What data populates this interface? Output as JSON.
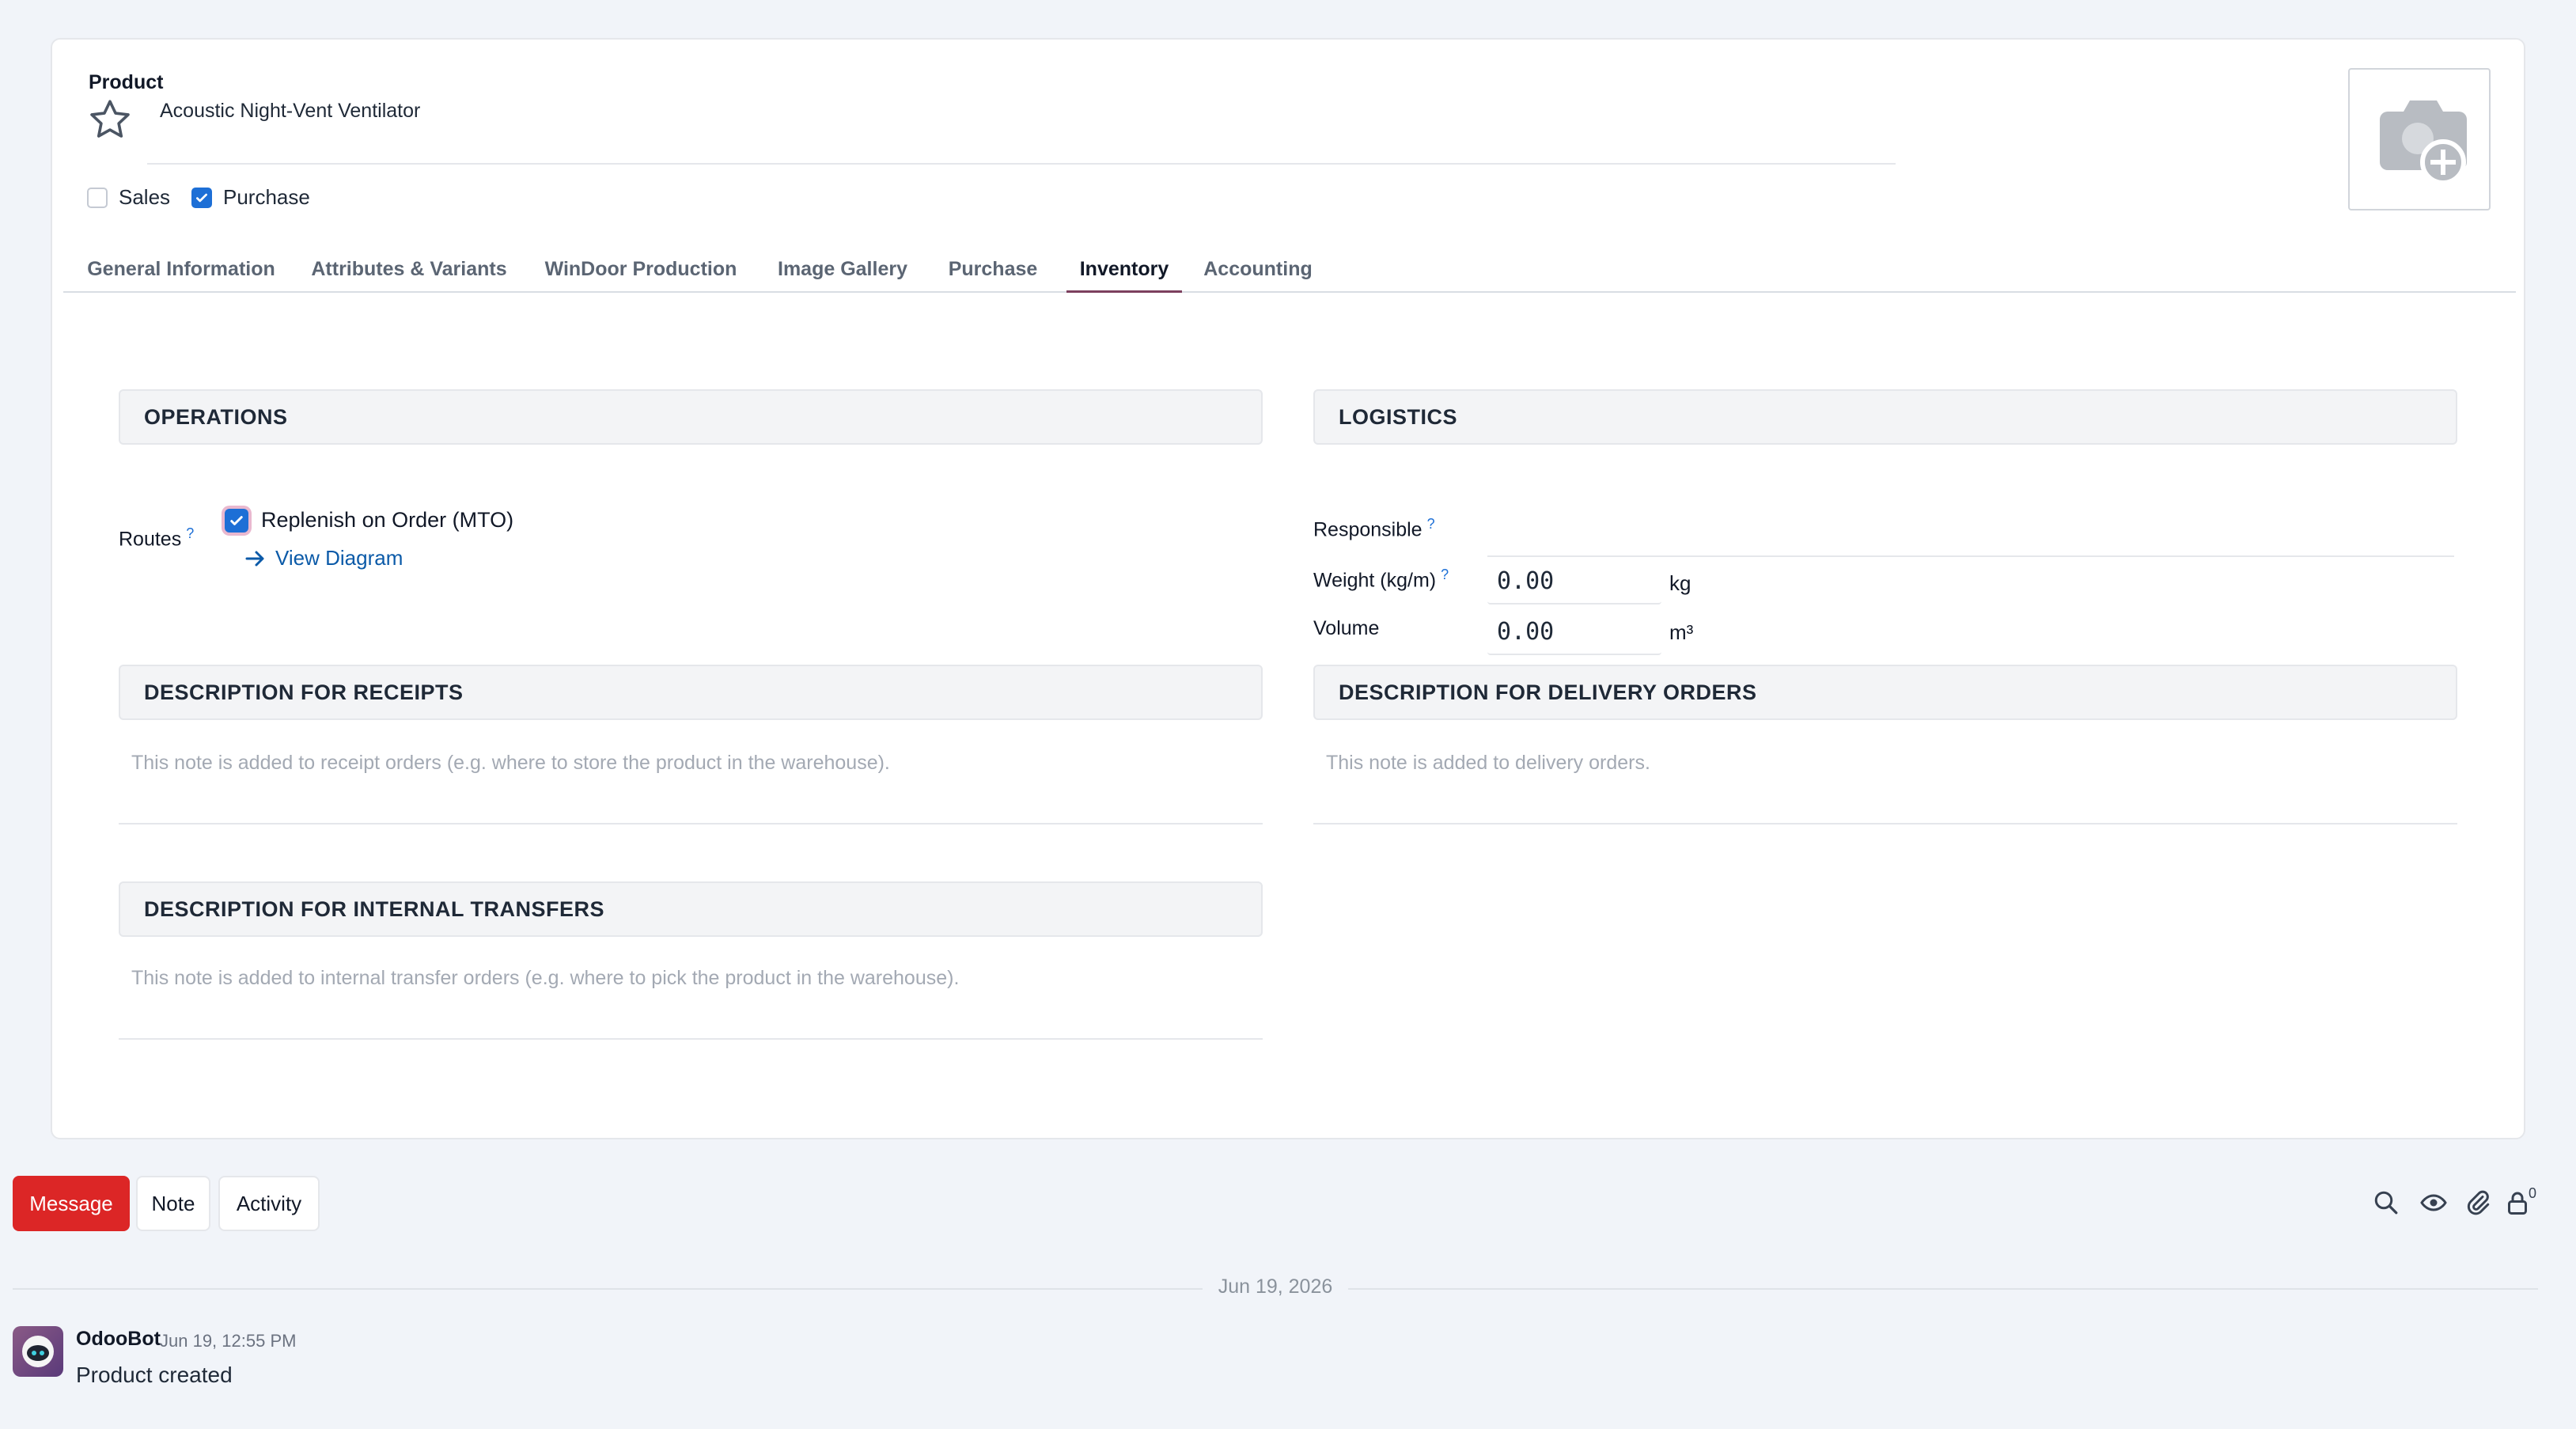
{
  "product": {
    "field_label": "Product",
    "name": "Acoustic Night-Vent Ventilator",
    "sales_label": "Sales",
    "sales_checked": false,
    "purchase_label": "Purchase",
    "purchase_checked": true
  },
  "tabs": [
    {
      "label": "General Information",
      "active": false
    },
    {
      "label": "Attributes & Variants",
      "active": false
    },
    {
      "label": "WinDoor Production",
      "active": false
    },
    {
      "label": "Image Gallery",
      "active": false
    },
    {
      "label": "Purchase",
      "active": false
    },
    {
      "label": "Inventory",
      "active": true
    },
    {
      "label": "Accounting",
      "active": false
    }
  ],
  "operations": {
    "title": "OPERATIONS",
    "routes_label": "Routes",
    "help": "?",
    "route_item": "Replenish on Order (MTO)",
    "route_checked": true,
    "view_diagram": "View Diagram"
  },
  "logistics": {
    "title": "LOGISTICS",
    "responsible_label": "Responsible",
    "weight_label": "Weight (kg/m)",
    "weight_value": "0.00",
    "weight_unit": "kg",
    "volume_label": "Volume",
    "volume_value": "0.00",
    "volume_unit": "m³",
    "help": "?"
  },
  "descriptions": {
    "receipts_title": "DESCRIPTION FOR RECEIPTS",
    "receipts_placeholder": "This note is added to receipt orders (e.g. where to store the product in the warehouse).",
    "delivery_title": "DESCRIPTION FOR DELIVERY ORDERS",
    "delivery_placeholder": "This note is added to delivery orders.",
    "internal_title": "DESCRIPTION FOR INTERNAL TRANSFERS",
    "internal_placeholder": "This note is added to internal transfer orders (e.g. where to pick the product in the warehouse)."
  },
  "chatter": {
    "message_btn": "Message",
    "note_btn": "Note",
    "activity_btn": "Activity",
    "followers_count": "0",
    "date_divider": "Jun 19, 2026",
    "author": "OdooBot",
    "timestamp": "Jun 19, 12:55 PM",
    "message": "Product created"
  },
  "icons": {
    "favorite": "star-icon",
    "image_placeholder": "camera-plus-icon",
    "search": "search-icon",
    "followers": "eye-icon",
    "attachments": "paperclip-icon",
    "subscribers": "lock-user-icon"
  },
  "colors": {
    "primary_button": "#dc2626",
    "checkbox": "#1d6fd6",
    "tab_active_underline": "#7c3f5e",
    "link": "#0b5aa8"
  }
}
